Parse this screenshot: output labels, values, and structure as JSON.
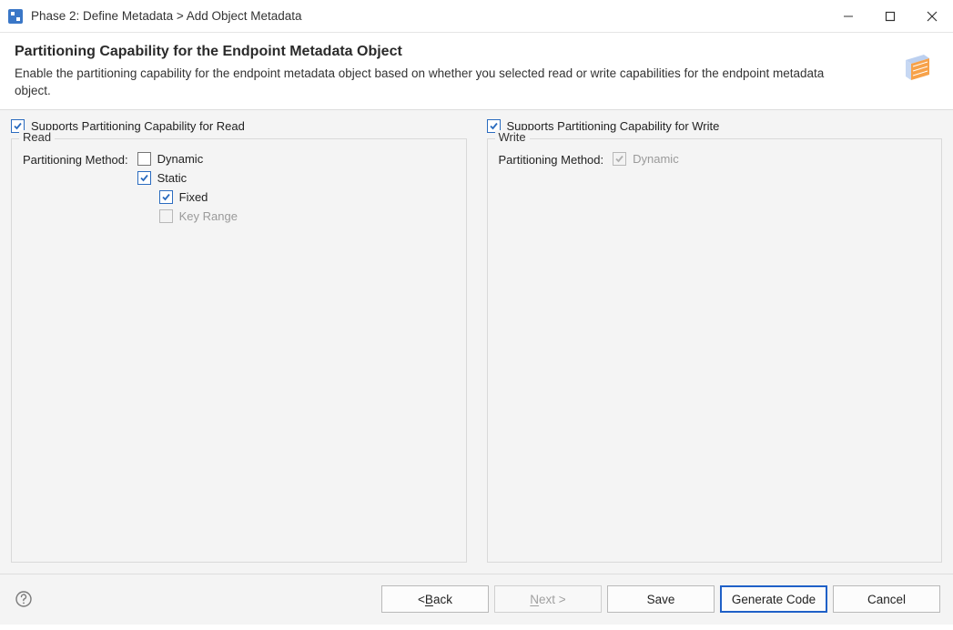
{
  "titlebar": {
    "text": "Phase 2: Define Metadata > Add Object Metadata"
  },
  "banner": {
    "title": "Partitioning Capability for the Endpoint Metadata Object",
    "description": "Enable the partitioning capability for the endpoint metadata object based on whether you selected read or write capabilities for the endpoint metadata object."
  },
  "left": {
    "supports_label": "Supports Partitioning Capability for Read",
    "fieldset_label": "Read",
    "pm_label": "Partitioning Method:",
    "options": {
      "dynamic": "Dynamic",
      "static": "Static",
      "fixed": "Fixed",
      "keyrange": "Key Range"
    }
  },
  "right": {
    "supports_label": "Supports Partitioning Capability for Write",
    "fieldset_label": "Write",
    "pm_label": "Partitioning Method:",
    "options": {
      "dynamic": "Dynamic"
    }
  },
  "footer": {
    "back_prefix": "< ",
    "back_mnemonic": "B",
    "back_suffix": "ack",
    "next_mnemonic": "N",
    "next_suffix": "ext >",
    "save": "Save",
    "generate": "Generate Code",
    "cancel": "Cancel"
  }
}
